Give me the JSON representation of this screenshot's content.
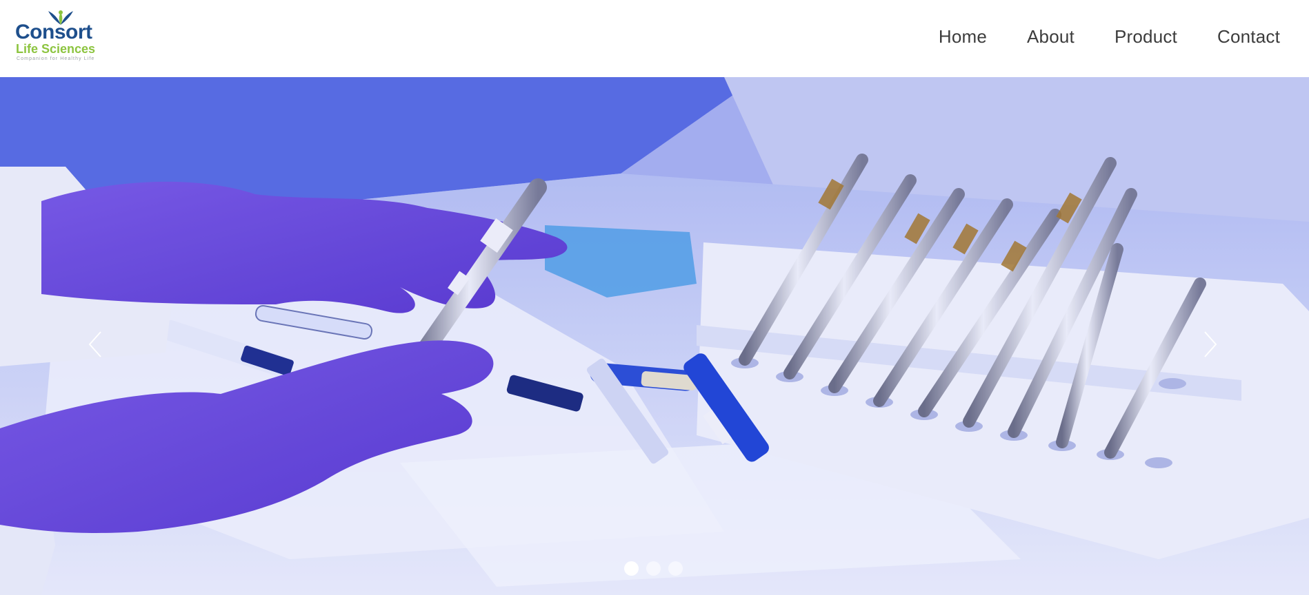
{
  "brand": {
    "name": "Consort",
    "subtitle": "Life Sciences",
    "tagline": "Companion for Healthy Life",
    "colors": {
      "primary": "#1e4f8c",
      "secondary": "#8cc43f"
    }
  },
  "nav": {
    "items": [
      {
        "label": "Home"
      },
      {
        "label": "About"
      },
      {
        "label": "Product"
      },
      {
        "label": "Contact"
      }
    ]
  },
  "hero": {
    "slide_count": 3,
    "active_slide": 1,
    "prev_icon": "chevron-left-icon",
    "next_icon": "chevron-right-icon"
  }
}
